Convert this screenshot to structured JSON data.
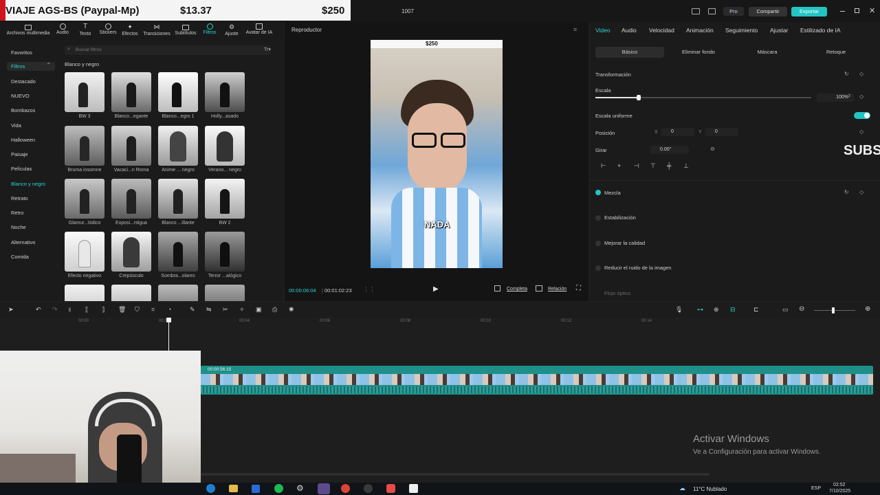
{
  "overlay": {
    "title": "VIAJE AGS-BS (Paypal-Mp)",
    "amount1": "$13.37",
    "amount2": "$250"
  },
  "titlebar": {
    "project_name": "1007",
    "pro_label": "Pro",
    "share_label": "Compartir",
    "export_label": "Exportar"
  },
  "toolbar": {
    "items": [
      {
        "label": "Archivos multimedia",
        "icon": "media-icon"
      },
      {
        "label": "Audio",
        "icon": "audio-icon"
      },
      {
        "label": "Texto",
        "icon": "text-icon"
      },
      {
        "label": "Stickers",
        "icon": "sticker-icon"
      },
      {
        "label": "Efectos",
        "icon": "effects-icon"
      },
      {
        "label": "Transiciones",
        "icon": "transitions-icon"
      },
      {
        "label": "Subtítulos",
        "icon": "subtitles-icon"
      },
      {
        "label": "Filtros",
        "icon": "filters-icon"
      },
      {
        "label": "Ajuste",
        "icon": "adjust-icon"
      },
      {
        "label": "Avatar de IA",
        "icon": "avatar-icon"
      }
    ],
    "active": "Filtros"
  },
  "filters": {
    "categories": [
      "Favoritos",
      "Filtros",
      "Destacado",
      "NUEVO",
      "Bombazos",
      "Vida",
      "Halloween",
      "Paisaje",
      "Películas",
      "Blanco y negro",
      "Retrato",
      "Retro",
      "Noche",
      "Alternativo",
      "Comida"
    ],
    "active_category": "Blanco y negro",
    "search_placeholder": "Buscar filtros",
    "section_title": "Blanco y negro",
    "items": [
      "BW 3",
      "Blanco...egante",
      "Blanco...egro 1",
      "Holly...asado",
      "Bruma insomne",
      "Vacaci...n Roma",
      "Anime ... negro",
      "Verano... negro",
      "Glamur...lódico",
      "Exposi...ntigua",
      "Blanco ...illante",
      "BW 2",
      "Efecto negativo",
      "Crepúsculo",
      "Sombra...olares",
      "Terror ...alógico"
    ]
  },
  "player": {
    "title": "Reproductor",
    "price_tag": "$250",
    "caption": "NADA",
    "current_time": "00:00:06:04",
    "total_time": "00:01:02:23",
    "full_label": "Completa",
    "ratio_label": "Relación"
  },
  "inspector": {
    "tabs": [
      "Video",
      "Audio",
      "Velocidad",
      "Animación",
      "Seguimiento",
      "Ajustar",
      "Estilizado de IA"
    ],
    "active_tab": "Video",
    "subtabs": [
      "Básico",
      "Eliminar fondo",
      "Máscara",
      "Retoque"
    ],
    "active_subtab": "Básico",
    "transform_label": "Transformación",
    "scale_label": "Escala",
    "scale_value": "100%",
    "scale_fraction": 0.2,
    "uniform_label": "Escala uniforme",
    "position_label": "Posición",
    "pos_x_label": "X",
    "pos_x": "0",
    "pos_y_label": "Y",
    "pos_y": "0",
    "rotate_label": "Girar",
    "rotate_value": "0.00°",
    "blend_label": "Mezcla",
    "stabilize_label": "Estabilización",
    "quality_label": "Mejorar la calidad",
    "denoise_label": "Reducir el ruido de la imagen",
    "optical_flow_label": "Flujo óptico",
    "subs_watermark": "SUBS"
  },
  "timeline": {
    "ruler": [
      "00:00",
      "00:02",
      "00:04",
      "00:06",
      "00:08",
      "00:10",
      "00:12",
      "00:14"
    ],
    "clip_time": "00:00:56:15"
  },
  "windows": {
    "activate_title": "Activar Windows",
    "activate_sub": "Ve a Configuración para activar Windows."
  },
  "taskbar": {
    "weather": "11°C  Nublado",
    "lang": "ESP",
    "time": "02:52",
    "date": "7/10/2025"
  },
  "colors": {
    "accent": "#2bd4cf",
    "clip": "#1f8f8a",
    "bg": "#1e1e1e"
  }
}
